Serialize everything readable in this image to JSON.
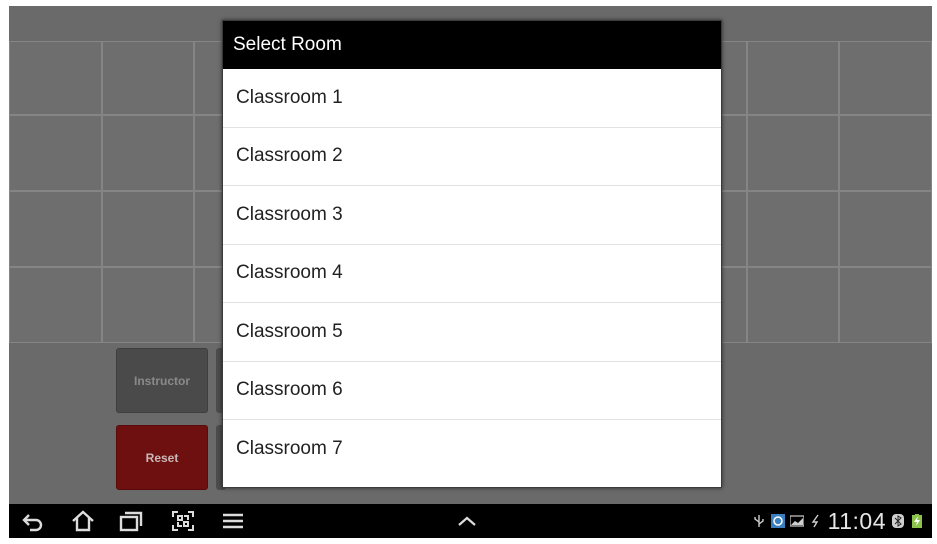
{
  "dialog": {
    "title": "Select Room",
    "items": [
      {
        "label": "Classroom 1"
      },
      {
        "label": "Classroom 2"
      },
      {
        "label": "Classroom 3"
      },
      {
        "label": "Classroom 4"
      },
      {
        "label": "Classroom 5"
      },
      {
        "label": "Classroom 6"
      },
      {
        "label": "Classroom 7"
      }
    ]
  },
  "app": {
    "instructor_label": "Instructor",
    "reset_label": "Reset",
    "reset_color": "#6e1010"
  },
  "navbar": {
    "icons": [
      "back-icon",
      "home-icon",
      "recent-apps-icon",
      "screenshot-icon",
      "menu-icon",
      "chevron-up-icon"
    ],
    "status_icons": [
      "usb-icon",
      "app-notification-icon",
      "image-notification-icon",
      "sync-icon",
      "bluetooth-icon",
      "battery-charging-icon"
    ],
    "clock": "11:04"
  }
}
